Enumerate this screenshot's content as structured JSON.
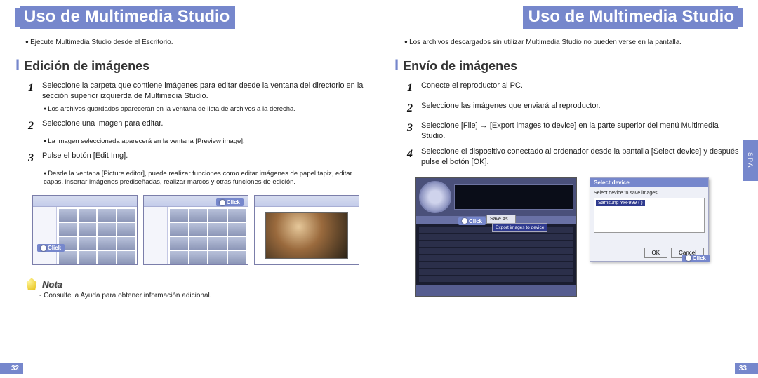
{
  "pages": {
    "left": {
      "title": "Uso de Multimedia Studio",
      "intro_bullet": "Ejecute Multimedia Studio desde el Escritorio.",
      "section": "Edición de imágenes",
      "steps": [
        {
          "n": "1",
          "text": "Seleccione la carpeta que contiene imágenes para editar desde la ventana del directorio en la sección superior izquierda de Multimedia Studio.",
          "sub": "Los archivos guardados aparecerán en la ventana de lista de archivos a la derecha."
        },
        {
          "n": "2",
          "text": "Seleccione una imagen para editar.",
          "sub": "La imagen seleccionada aparecerá en la ventana [Preview image]."
        },
        {
          "n": "3",
          "text": "Pulse el botón [Edit Img].",
          "sub": "Desde la ventana [Picture editor], puede realizar funciones como editar imágenes de papel tapiz, editar capas, insertar imágenes prediseñadas, realizar marcos y otras funciones de edición."
        }
      ],
      "click_label": "Click",
      "nota_label": "Nota",
      "nota_text": "- Consulte la Ayuda para obtener información adicional.",
      "page_num": "32"
    },
    "right": {
      "title": "Uso de Multimedia Studio",
      "intro_bullet": "Los archivos descargados sin utilizar Multimedia Studio no pueden verse en la pantalla.",
      "section": "Envío de imágenes",
      "steps": [
        {
          "n": "1",
          "text": "Conecte el reproductor al PC."
        },
        {
          "n": "2",
          "text": "Seleccione las imágenes que enviará al reproductor."
        },
        {
          "n": "3",
          "text": "Seleccione [File] → [Export images to device] en la parte superior del menú Multimedia Studio."
        },
        {
          "n": "4",
          "text": "Seleccione el dispositivo conectado al ordenador desde la pantalla [Select device] y después pulse el botón [OK]."
        }
      ],
      "click_label": "Click",
      "player_menu_saveas": "Save As...",
      "player_menu_export": "Export images to device",
      "dialog": {
        "title": "Select device",
        "body": "Select device to save images",
        "item": "Samsung YH-999 ( )",
        "ok": "OK",
        "cancel": "Cancel"
      },
      "side_tab": "SPA",
      "page_num": "33"
    }
  }
}
